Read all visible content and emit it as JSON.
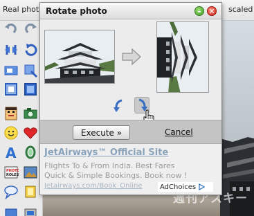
{
  "background": {
    "topbar_left": "Real photo",
    "topbar_right": "scaled",
    "watermark": "週刊アスキー"
  },
  "toolbar": {
    "tools": [
      {
        "icon": "undo-icon"
      },
      {
        "icon": "redo-icon"
      },
      {
        "icon": "flip-icon"
      },
      {
        "icon": "rotate-icon"
      },
      {
        "icon": "resize-icon"
      },
      {
        "icon": "crop-icon"
      },
      {
        "icon": "frame-icon"
      },
      {
        "icon": "border-icon"
      },
      {
        "icon": "face-icon"
      },
      {
        "icon": "camera-icon"
      },
      {
        "icon": "smiley-icon"
      },
      {
        "icon": "heart-icon"
      },
      {
        "icon": "text-icon"
      },
      {
        "icon": "shape-icon"
      },
      {
        "icon": "sticker-icon"
      },
      {
        "icon": "photo-icon"
      },
      {
        "icon": "speech-bubble-icon"
      },
      {
        "icon": "paint-icon"
      }
    ]
  },
  "dialog": {
    "title": "Rotate photo",
    "minimize_icon": "minimize-icon",
    "close_icon": "close-icon",
    "execute_label": "Execute »",
    "cancel_label": "Cancel"
  },
  "ad": {
    "title": "JetAirways™ Official Site",
    "line1": "Flights To & From India. Best Fares",
    "line2": "Quick & Simple Bookings. Book now !",
    "url": "Jetairways.com/Book_Online",
    "adchoices": "AdChoices"
  },
  "colors": {
    "ad_title": "#8aa3bb",
    "dialog_bg": "#ececec",
    "exec_bar": "#c4c4c4"
  }
}
